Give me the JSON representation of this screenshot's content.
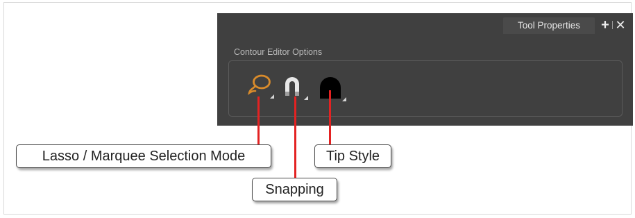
{
  "panel": {
    "tab_label": "Tool Properties",
    "add_icon": "plus-icon",
    "close_icon": "close-icon",
    "group_title": "Contour Editor Options"
  },
  "tools": [
    {
      "name": "lasso-selection-tool",
      "icon": "lasso-icon",
      "color": "#d98b2b"
    },
    {
      "name": "snapping-tool",
      "icon": "magnet-icon",
      "color": "#e8e8e8"
    },
    {
      "name": "tip-style-tool",
      "icon": "tip-style-icon",
      "color": "#000000"
    }
  ],
  "callouts": {
    "lasso": "Lasso / Marquee Selection Mode",
    "snapping": "Snapping",
    "tip_style": "Tip Style"
  },
  "colors": {
    "panel_bg": "#404040",
    "callout_line": "#e32222"
  }
}
